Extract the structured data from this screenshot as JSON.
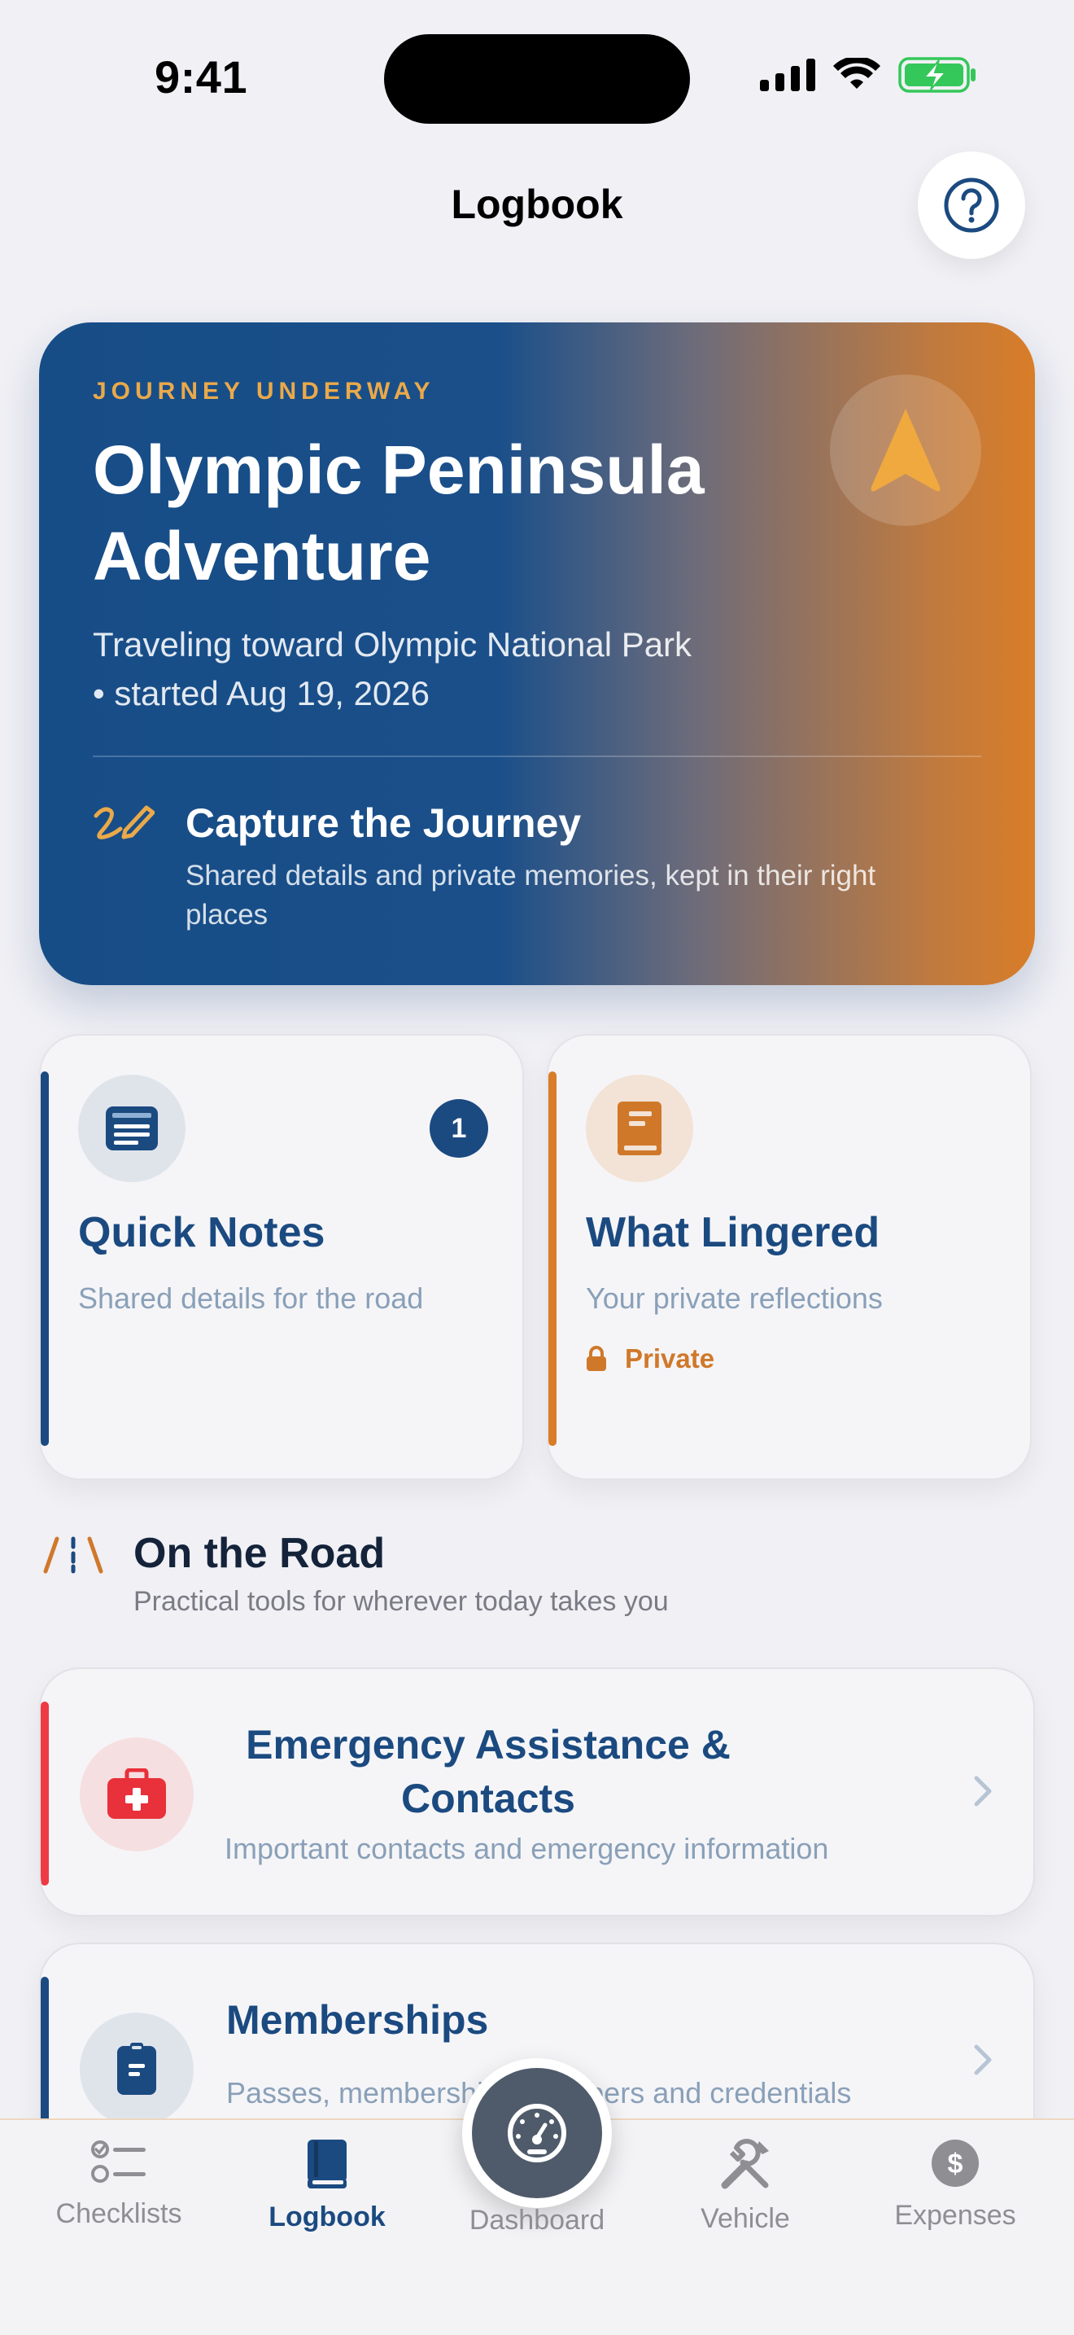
{
  "status_bar": {
    "time": "9:41"
  },
  "header": {
    "title": "Logbook",
    "help_icon": "question-circle-icon"
  },
  "hero": {
    "eyebrow": "JOURNEY UNDERWAY",
    "title": "Olympic Peninsula Adventure",
    "subtitle": "Traveling toward Olympic National Park • started Aug 19, 2026",
    "badge_icon": "navigation-arrow-icon",
    "capture_title": "Capture the Journey",
    "capture_subtitle": "Shared details and private memories, kept in their right places",
    "colors": {
      "start": "#174d87",
      "end": "#d97d28",
      "accent": "#eaa94a"
    }
  },
  "cards": [
    {
      "title": "Quick Notes",
      "subtitle": "Shared details for the road",
      "badge_count": "1",
      "icon": "note-icon",
      "accent": "#1b4a80"
    },
    {
      "title": "What Lingered",
      "subtitle": "Your private reflections",
      "tag": "Private",
      "icon": "journal-book-icon",
      "accent": "#d97d28"
    }
  ],
  "section": {
    "title": "On the Road",
    "subtitle": "Practical tools for wherever today takes you",
    "icon": "road-icon"
  },
  "rows": [
    {
      "title": "Emergency Assistance & Contacts",
      "subtitle": "Important contacts and emergency information",
      "icon": "first-aid-kit-icon",
      "accent": "#ee3a43"
    },
    {
      "title": "Memberships",
      "subtitle": "Passes, memberships, numbers and credentials",
      "icon": "id-card-icon",
      "accent": "#1b4a80"
    }
  ],
  "tabs": [
    {
      "label": "Checklists",
      "icon": "checklist-icon",
      "active": false
    },
    {
      "label": "Logbook",
      "icon": "logbook-icon",
      "active": true
    },
    {
      "label": "Dashboard",
      "icon": "speedometer-icon",
      "active": false
    },
    {
      "label": "Vehicle",
      "icon": "wrench-screwdriver-icon",
      "active": false
    },
    {
      "label": "Expenses",
      "icon": "dollar-circle-icon",
      "active": false
    }
  ]
}
